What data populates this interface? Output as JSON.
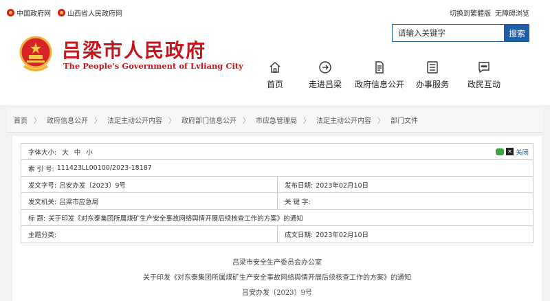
{
  "topbar": {
    "links": [
      "中国政府网",
      "山西省人民政府网"
    ],
    "right": [
      "切换到繁體版",
      "无障碍浏览"
    ]
  },
  "header": {
    "title": "吕梁市人民政府",
    "subtitle": "The People's Government of Lvliang City"
  },
  "search": {
    "placeholder": "请输入关键字",
    "button": "搜索"
  },
  "nav": [
    {
      "label": "首页",
      "icon": "home-icon"
    },
    {
      "label": "走进吕梁",
      "icon": "arrow-circle-icon"
    },
    {
      "label": "政府信息公开",
      "icon": "document-icon"
    },
    {
      "label": "办事服务",
      "icon": "list-icon"
    },
    {
      "label": "政民互动",
      "icon": "chat-icon"
    }
  ],
  "breadcrumb": [
    "首页",
    "政府信息公开",
    "法定主动公开内容",
    "政府部门信息公开",
    "市应急管理局",
    "法定主动公开内容",
    "部门文件"
  ],
  "meta": {
    "fontsize_label": "字体大小:",
    "fontsize_options": [
      "大",
      "中",
      "小"
    ],
    "close": "关闭",
    "index_label": "索  引  号:",
    "index_value": "111423LL00100/2023-18187",
    "docno_label": "发文字号:",
    "docno_value": "吕安办发〔2023〕9号",
    "pubdate_label": "发布日期:",
    "pubdate_value": "2023年02月10日",
    "org_label": "发文机关:",
    "org_value": "吕梁市应急局",
    "keyword_label": "关  键  字:",
    "keyword_value": "",
    "title_label": "标      题:",
    "title_value": "关于印发《对东泰集团所属煤矿生产安全事故网络舆情开展后续核查工作的方案》的通知",
    "topic_label": "主题分类:",
    "topic_value": "",
    "gendate_label": "成文日期:",
    "gendate_value": "2023年02月10日"
  },
  "doc": {
    "line1": "吕梁市安全生产委员会办公室",
    "line2": "关于印发《对东泰集团所属煤矿生产安全事故网络舆情开展后续核查工作的方案》的通知",
    "line3": "吕安办发〔2023〕9号"
  },
  "colors": {
    "brand_red": "#c4161c",
    "accent_blue": "#1f5fa8"
  }
}
